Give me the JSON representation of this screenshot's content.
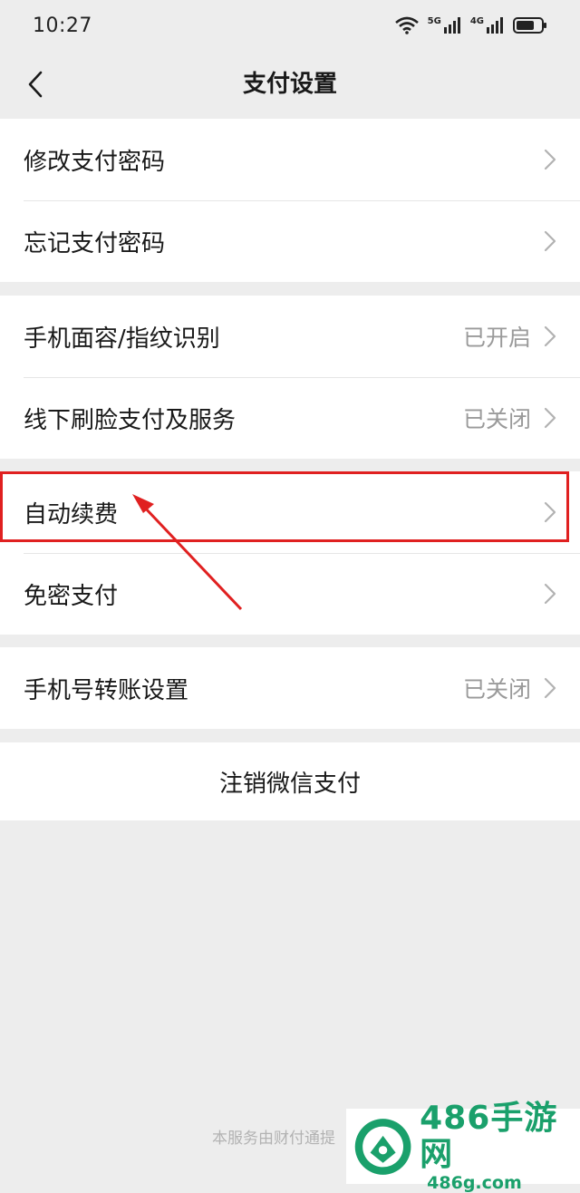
{
  "status_bar": {
    "time": "10:27",
    "signal_1": "5G",
    "signal_2": "4G"
  },
  "header": {
    "title": "支付设置",
    "back_icon": "chevron-left-icon"
  },
  "groups": [
    {
      "items": [
        {
          "label": "修改支付密码",
          "value": ""
        },
        {
          "label": "忘记支付密码",
          "value": ""
        }
      ]
    },
    {
      "items": [
        {
          "label": "手机面容/指纹识别",
          "value": "已开启"
        },
        {
          "label": "线下刷脸支付及服务",
          "value": "已关闭"
        }
      ]
    },
    {
      "items": [
        {
          "label": "自动续费",
          "value": ""
        },
        {
          "label": "免密支付",
          "value": ""
        }
      ]
    },
    {
      "items": [
        {
          "label": "手机号转账设置",
          "value": "已关闭"
        }
      ]
    }
  ],
  "logout_label": "注销微信支付",
  "footer_note": "本服务由财付通提",
  "annotation": {
    "highlight_color": "#e02020",
    "target": "自动续费"
  },
  "watermark": {
    "title": "486手游网",
    "subtitle": "486g.com",
    "color": "#1aa06b"
  }
}
